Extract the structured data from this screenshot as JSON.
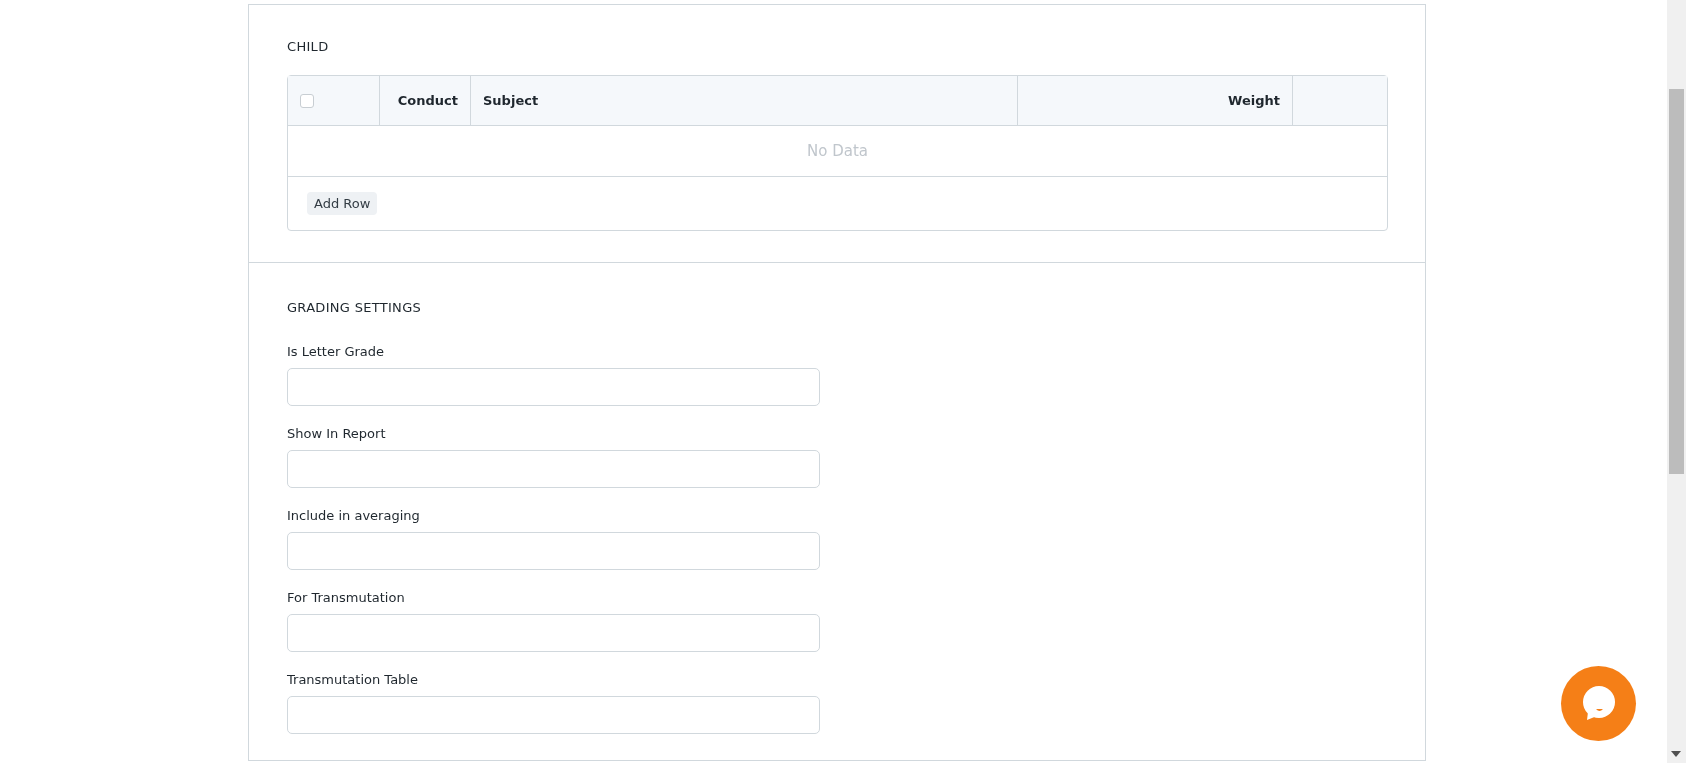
{
  "child_section": {
    "title": "CHILD",
    "table": {
      "select_all": {
        "checked": false
      },
      "columns": [
        {
          "label": "Conduct",
          "kind": "numeric"
        },
        {
          "label": "Subject",
          "kind": "text"
        },
        {
          "label": "Weight",
          "kind": "numeric"
        }
      ],
      "empty_text": "No Data",
      "add_button": "Add Row"
    }
  },
  "grading_settings": {
    "title": "GRADING SETTINGS",
    "fields": [
      {
        "label": "Is Letter Grade"
      },
      {
        "label": "Show In Report"
      },
      {
        "label": "Include in averaging"
      },
      {
        "label": "For Transmutation"
      },
      {
        "label": "Transmutation Table"
      }
    ]
  }
}
